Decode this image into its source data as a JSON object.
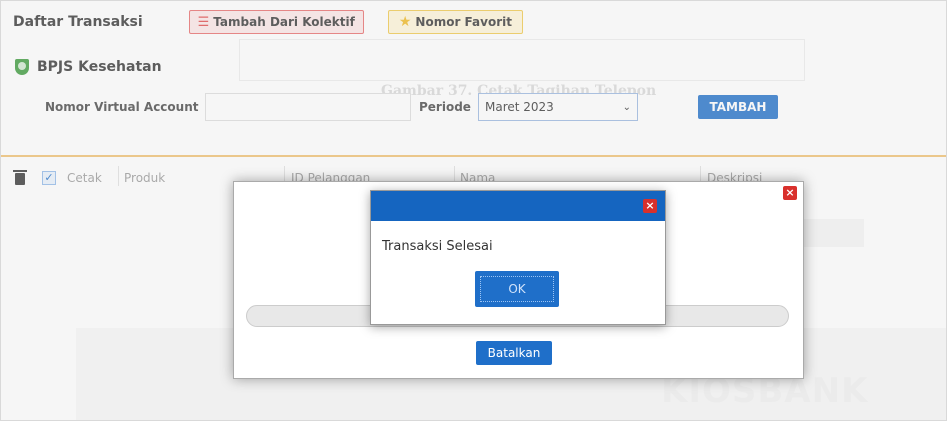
{
  "header": {
    "title": "Daftar Transaksi",
    "kolektif_label": "Tambah Dari Kolektif",
    "favorit_label": "Nomor Favorit"
  },
  "background": {
    "ghost_caption": "Gambar 37. Cetak Tagihan Telepon",
    "watermark": "KIOSBANK"
  },
  "section": {
    "title": "BPJS Kesehatan"
  },
  "form": {
    "va_label": "Nomor Virtual Account",
    "va_value": "",
    "periode_label": "Periode",
    "periode_value": "Maret 2023",
    "tambah_label": "TAMBAH"
  },
  "table": {
    "print_label": "Cetak",
    "columns": [
      "Produk",
      "ID Pelanggan",
      "Nama",
      "Deskripsi"
    ]
  },
  "progress_dialog": {
    "cancel_label": "Batalkan",
    "close_icon": "×"
  },
  "alert": {
    "message": "Transaksi Selesai",
    "ok_label": "OK",
    "close_icon": "×"
  },
  "colors": {
    "accent_blue": "#1f6fc9",
    "header_blue": "#1565c0",
    "close_red": "#d9302c",
    "divider_orange": "#f0c070"
  }
}
